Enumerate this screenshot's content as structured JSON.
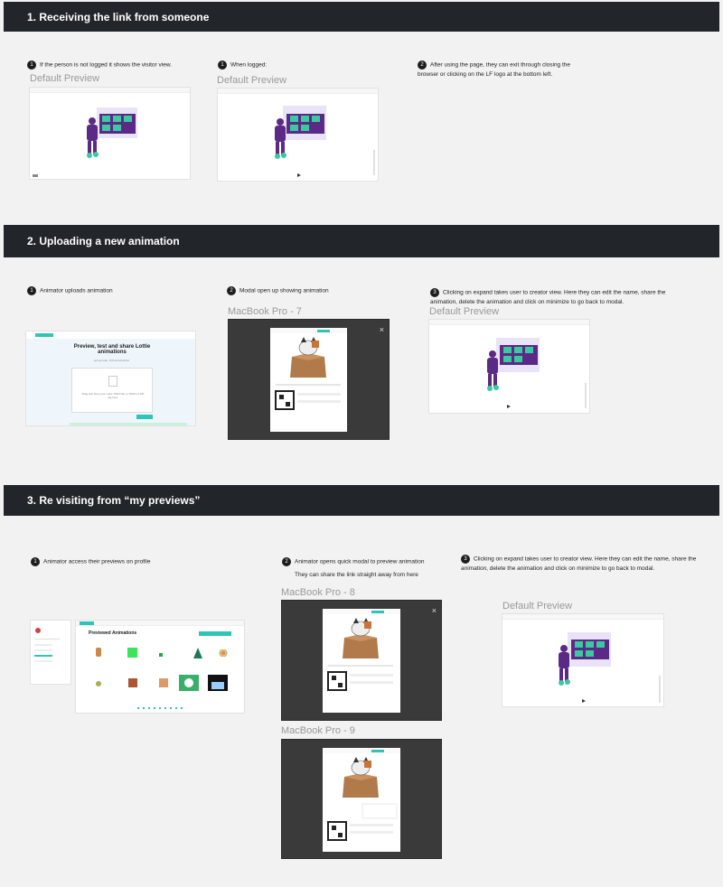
{
  "sections": [
    {
      "title": "1. Receiving the link from someone"
    },
    {
      "title": "2. Uploading a new animation"
    },
    {
      "title": "3. Re visiting from “my previews”"
    }
  ],
  "s1": {
    "step1": {
      "n": "1",
      "text": "If the person is not logged it shows the visitor view."
    },
    "step1b": {
      "n": "1",
      "text": "When logged:"
    },
    "step2": {
      "n": "2",
      "text": "After using the page, they can exit through closing the browser or clicking on the LF logo at the bottom left."
    },
    "cap1": "Default Preview",
    "cap2": "Default Preview"
  },
  "s2": {
    "step1": {
      "n": "1",
      "text": "Animator uploads animation"
    },
    "step2": {
      "n": "2",
      "text": "Modal open up showing animation"
    },
    "step3": {
      "n": "3",
      "text": "Clicking on expand takes user to creator view. Here they can edit the name, share the animation, delete the animation and click on minimize to go back to modal."
    },
    "cap_mac": "MacBook Pro - 7",
    "cap_def": "Default Preview",
    "upload_title": "Preview, test and share Lottie animations",
    "upload_sub": "across web, iOS and Android",
    "upload_drop": "Drag and drop your Lottie JSON file or JSON or ZIP file here"
  },
  "s3": {
    "step1": {
      "n": "1",
      "text": "Animator access their previews on profile"
    },
    "step2": {
      "n": "2",
      "text": "Animator opens quick modal to preview animation"
    },
    "step2b": "They can share the link straight away from here",
    "step3": {
      "n": "3",
      "text": "Clicking on expand takes user to creator view. Here they can edit the name, share the animation, delete the animation and click on minimize to go back to modal."
    },
    "cap_mac8": "MacBook Pro - 8",
    "cap_mac9": "MacBook Pro - 9",
    "cap_def": "Default Preview",
    "profile_title": "Previewed Animations",
    "close_icon": "×"
  },
  "colors": {
    "band": "#22262b",
    "teal": "#2ec4b6",
    "purple": "#5b2a86",
    "panel": "#e9e3f7"
  }
}
